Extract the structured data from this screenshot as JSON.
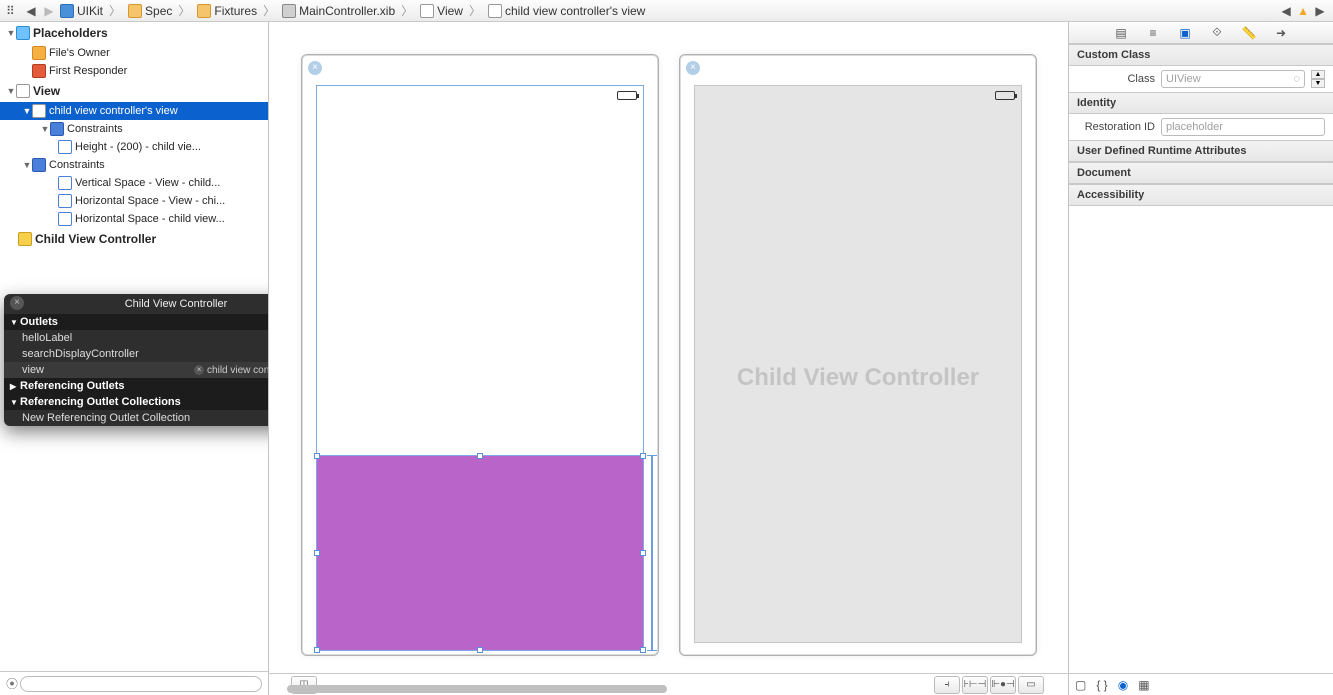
{
  "breadcrumb": {
    "items": [
      {
        "icon": "blue",
        "label": "UIKit"
      },
      {
        "icon": "folder",
        "label": "Spec"
      },
      {
        "icon": "folder",
        "label": "Fixtures"
      },
      {
        "icon": "xib",
        "label": "MainController.xib"
      },
      {
        "icon": "view",
        "label": "View"
      },
      {
        "icon": "view",
        "label": "child view controller's view"
      }
    ]
  },
  "outline": {
    "placeholders_label": "Placeholders",
    "files_owner": "File's Owner",
    "first_responder": "First Responder",
    "view_label": "View",
    "child_view": "child view controller's view",
    "constraints_label": "Constraints",
    "height_constraint": "Height - (200) - child vie...",
    "vspace": "Vertical Space - View - child...",
    "hspace1": "Horizontal Space - View - chi...",
    "hspace2": "Horizontal Space - child view...",
    "child_vc": "Child View Controller"
  },
  "popup": {
    "title": "Child View Controller",
    "outlets": "Outlets",
    "helloLabel": "helloLabel",
    "sdc": "searchDisplayController",
    "view": "view",
    "view_conn": "child view controller's view",
    "ref_outlets": "Referencing Outlets",
    "ref_coll": "Referencing Outlet Collections",
    "new_ref": "New Referencing Outlet Collection"
  },
  "canvas": {
    "cvc_label": "Child View Controller"
  },
  "inspector": {
    "custom_class": "Custom Class",
    "class_label": "Class",
    "class_value": "UIView",
    "identity": "Identity",
    "restoration": "Restoration ID",
    "restoration_ph": "placeholder",
    "udra": "User Defined Runtime Attributes",
    "document": "Document",
    "accessibility": "Accessibility"
  },
  "search_placeholder": ""
}
